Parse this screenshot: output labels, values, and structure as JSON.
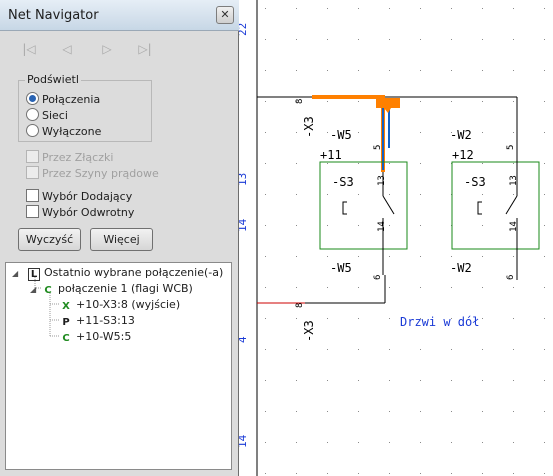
{
  "window": {
    "title": "Net Navigator",
    "close": "✕"
  },
  "nav_buttons": {
    "first": "|◁",
    "prev": "◁",
    "next": "▷",
    "last": "▷|"
  },
  "highlight": {
    "label": "Podświetl",
    "options": [
      {
        "label": "Połączenia",
        "selected": true
      },
      {
        "label": "Sieci",
        "selected": false
      },
      {
        "label": "Wyłączone",
        "selected": false
      }
    ]
  },
  "via": {
    "terminals": {
      "label": "Przez Złączki",
      "checked": false,
      "enabled": false
    },
    "busbars": {
      "label": "Przez Szyny prądowe",
      "checked": false,
      "enabled": false
    }
  },
  "selection": {
    "additive": {
      "label": "Wybór Dodający",
      "checked": false
    },
    "inverse": {
      "label": "Wybór Odwrotny",
      "checked": false
    }
  },
  "buttons": {
    "clear": "Wyczyść",
    "more": "Więcej"
  },
  "tree": {
    "root": {
      "icon": "L",
      "label": "Ostatnio wybrane połączenie(-a)"
    },
    "connection": {
      "icon": "C",
      "label": "połączenie 1 (flagi WCB)"
    },
    "children": [
      {
        "icon": "X",
        "label": "+10-X3:8 (wyjście)",
        "color": "#1f8a1f"
      },
      {
        "icon": "P",
        "label": "+11-S3:13",
        "color": "#1d1d1d"
      },
      {
        "icon": "C",
        "label": "+10-W5:5",
        "color": "#1f8a1f"
      }
    ]
  },
  "schematic": {
    "left_edge_labels": [
      "22",
      "13",
      "14",
      "4",
      "14"
    ],
    "x3_top": "-X3",
    "x3_top_pin": "8",
    "x3_bottom": "-X3",
    "x3_bottom_pin": "8",
    "left_block": {
      "w_top": "-W5",
      "w_top_pin": "5",
      "loc": "+11",
      "switch": "-S3",
      "pin_top": "13",
      "pin_bottom": "14",
      "w_bottom": "-W5",
      "w_bottom_pin": "6"
    },
    "right_block": {
      "w_top": "-W2",
      "w_top_pin": "5",
      "loc": "+12",
      "switch": "-S3",
      "pin_top": "13",
      "pin_bottom": "14",
      "w_bottom": "-W2",
      "w_bottom_pin": "6"
    },
    "annotation": "Drzwi w dół",
    "colors": {
      "wire": "#000000",
      "highlight_orange": "#ff8000",
      "highlight_blue": "#1560c0",
      "device_green": "#1a8a1a",
      "label_blue": "#1a3ad6",
      "red_wire": "#cc0000"
    }
  }
}
